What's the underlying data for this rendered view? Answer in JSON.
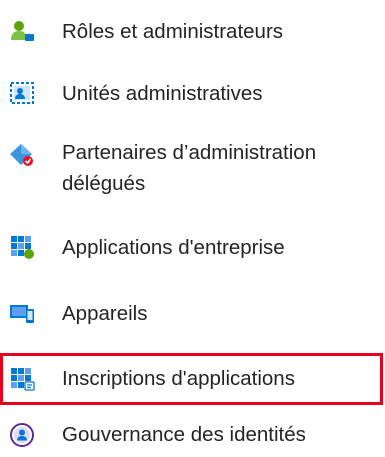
{
  "menu": {
    "items": [
      {
        "label": "Rôles et administrateurs",
        "icon": "users-admin-icon"
      },
      {
        "label": "Unités administratives",
        "icon": "admin-units-icon"
      },
      {
        "label": "Partenaires d’administration délégués",
        "icon": "delegated-partners-icon"
      },
      {
        "label": "Applications d'entreprise",
        "icon": "enterprise-apps-icon"
      },
      {
        "label": "Appareils",
        "icon": "devices-icon"
      },
      {
        "label": "Inscriptions d'applications",
        "icon": "app-registrations-icon",
        "selected": true
      },
      {
        "label": "Gouvernance des identités",
        "icon": "identity-governance-icon"
      }
    ]
  },
  "colors": {
    "highlight_border": "#e8001c",
    "icon_blue": "#0078d4",
    "icon_green": "#5ea20c",
    "icon_red": "#e81123"
  }
}
